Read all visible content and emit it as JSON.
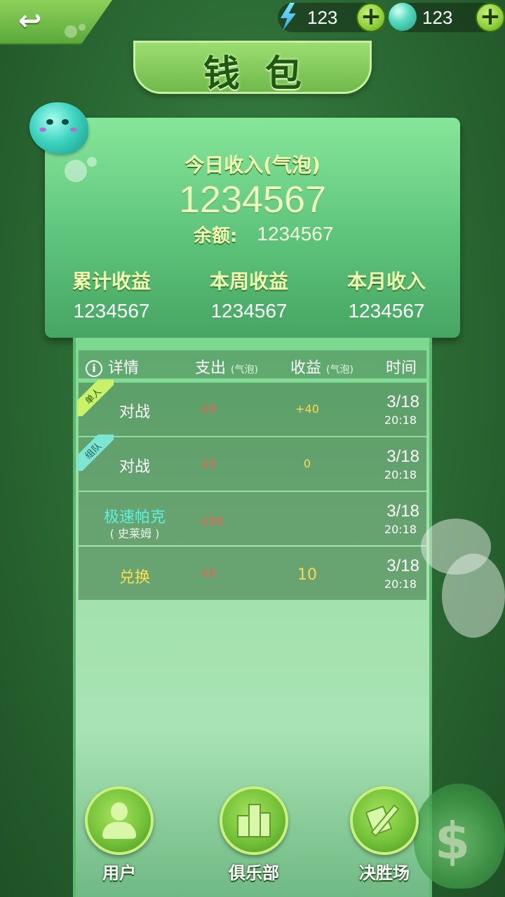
{
  "header": {
    "title": "钱包",
    "energy": {
      "icon": "lightning-icon",
      "value": "123"
    },
    "bubbles": {
      "icon": "bubble-icon",
      "value": "123"
    }
  },
  "summary": {
    "today_label": "今日收入(气泡)",
    "today_value": "1234567",
    "balance_label": "余额:",
    "balance_value": "1234567",
    "stats": [
      {
        "label": "累计收益",
        "value": "1234567"
      },
      {
        "label": "本周收益",
        "value": "1234567"
      },
      {
        "label": "本月收入",
        "value": "1234567"
      }
    ]
  },
  "table": {
    "headers": {
      "detail": "详情",
      "expense": "支出",
      "expense_unit": "(气泡)",
      "income": "收益",
      "income_unit": "(气泡)",
      "time": "时间"
    },
    "rows": [
      {
        "tag": "单人",
        "name": "对战",
        "sub": "",
        "expense": "-10",
        "income": "+40",
        "date": "3/18",
        "time": "20:18"
      },
      {
        "tag": "组队",
        "name": "对战",
        "sub": "",
        "expense": "-10",
        "income": "0",
        "date": "3/18",
        "time": "20:18"
      },
      {
        "tag": "",
        "name": "极速帕克",
        "sub": "( 史莱姆 )",
        "expense": "-150",
        "income": "",
        "date": "3/18",
        "time": "20:18"
      },
      {
        "tag": "",
        "name": "兑换",
        "sub": "",
        "expense": "-10",
        "income": "10",
        "date": "3/18",
        "time": "20:18"
      }
    ]
  },
  "nav": [
    {
      "label": "用户",
      "icon": "user-icon"
    },
    {
      "label": "俱乐部",
      "icon": "club-icon"
    },
    {
      "label": "决胜场",
      "icon": "battle-icon"
    }
  ],
  "colors": {
    "accent": "#74c23a",
    "expense": "#ff5a4a",
    "income": "#ffd84a",
    "highlight_cyan": "#5cf0e0",
    "highlight_yellow": "#ffe04a"
  }
}
